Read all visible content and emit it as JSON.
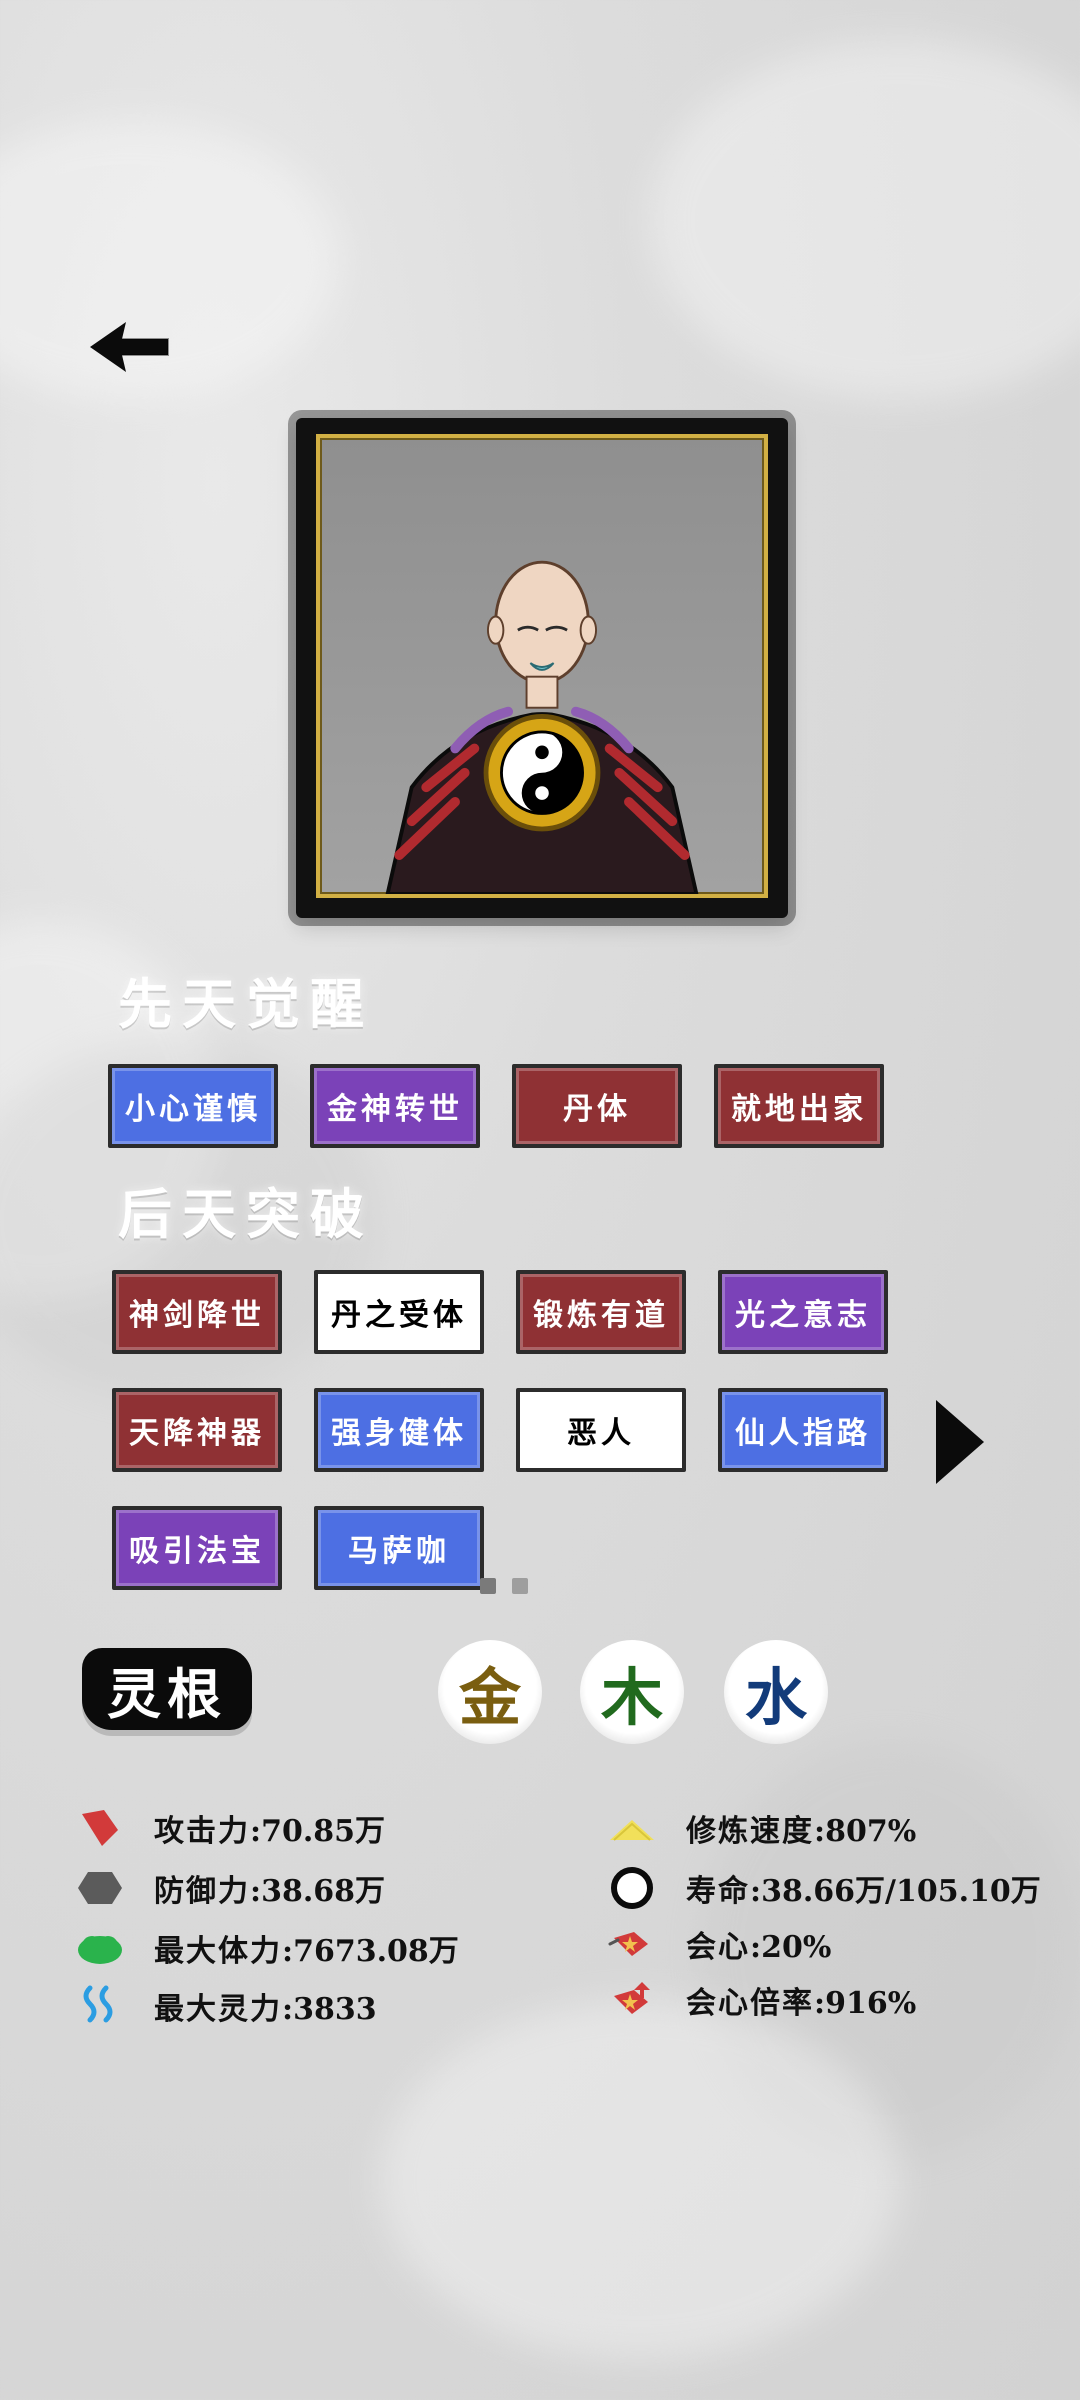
{
  "sections": {
    "innate_title": "先天觉醒",
    "acquired_title": "后天突破"
  },
  "innate_traits": [
    {
      "label": "小心谨慎",
      "color": "blue"
    },
    {
      "label": "金神转世",
      "color": "purple"
    },
    {
      "label": "丹体",
      "color": "red"
    },
    {
      "label": "就地出家",
      "color": "red"
    }
  ],
  "acquired_traits": [
    {
      "label": "神剑降世",
      "color": "red"
    },
    {
      "label": "丹之受体",
      "color": "white"
    },
    {
      "label": "锻炼有道",
      "color": "red"
    },
    {
      "label": "光之意志",
      "color": "purple"
    },
    {
      "label": "天降神器",
      "color": "red"
    },
    {
      "label": "强身健体",
      "color": "blue"
    },
    {
      "label": "恶人",
      "color": "white"
    },
    {
      "label": "仙人指路",
      "color": "blue"
    },
    {
      "label": "吸引法宝",
      "color": "purple"
    },
    {
      "label": "马萨咖",
      "color": "blue"
    }
  ],
  "pager": {
    "dots": 2,
    "active_index": 0
  },
  "lingen": {
    "label": "灵根",
    "elements": [
      {
        "char": "金",
        "color": "#7a5e10"
      },
      {
        "char": "木",
        "color": "#216a1e"
      },
      {
        "char": "水",
        "color": "#123b7a"
      }
    ]
  },
  "stats_left": [
    {
      "icon": "attack-icon",
      "label": "攻击力",
      "value": ":70.85万"
    },
    {
      "icon": "defense-icon",
      "label": "防御力",
      "value": ":38.68万"
    },
    {
      "icon": "max-health-icon",
      "label": "最大体力",
      "value": ":7673.08万"
    },
    {
      "icon": "max-spirit-icon",
      "label": "最大灵力",
      "value": ":3833"
    }
  ],
  "stats_right": [
    {
      "icon": "cultivation-speed-icon",
      "label": "修炼速度",
      "value": ":807%"
    },
    {
      "icon": "lifespan-icon",
      "label": "寿命",
      "value": ":38.66万/105.10万"
    },
    {
      "icon": "critical-icon",
      "label": "会心",
      "value": ":20%"
    },
    {
      "icon": "critical-multiplier-icon",
      "label": "会心倍率",
      "value": ":916%"
    }
  ]
}
